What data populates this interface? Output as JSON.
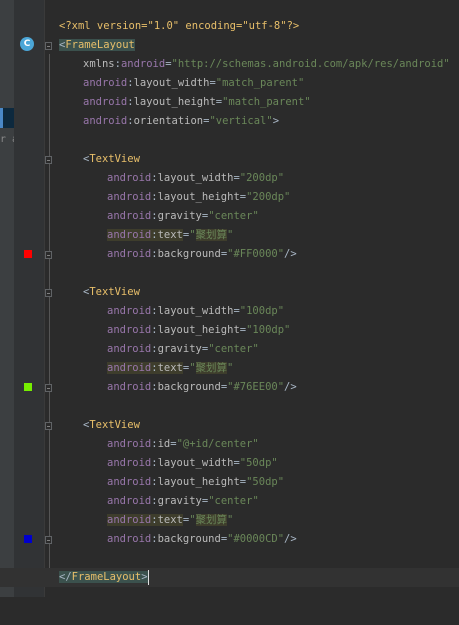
{
  "edge_text": "r a",
  "class_badge": "C",
  "lines": {
    "l1": {
      "decl": "<?xml version=\"1.0\" encoding=\"utf-8\"?>"
    },
    "l2": {
      "open": "<",
      "tag": "FrameLayout"
    },
    "l3": {
      "ns": "xmlns",
      "colon": ":",
      "attr": "android",
      "eq": "=",
      "val": "\"http://schemas.android.com/apk/res/android\""
    },
    "l4": {
      "ns": "android",
      "colon": ":",
      "attr": "layout_width",
      "eq": "=",
      "val": "\"match_parent\""
    },
    "l5": {
      "ns": "android",
      "colon": ":",
      "attr": "layout_height",
      "eq": "=",
      "val": "\"match_parent\""
    },
    "l6": {
      "ns": "android",
      "colon": ":",
      "attr": "orientation",
      "eq": "=",
      "val": "\"vertical\"",
      "close": ">"
    },
    "l8": {
      "open": "<",
      "tag": "TextView"
    },
    "l9": {
      "ns": "android",
      "colon": ":",
      "attr": "layout_width",
      "eq": "=",
      "val": "\"200dp\""
    },
    "l10": {
      "ns": "android",
      "colon": ":",
      "attr": "layout_height",
      "eq": "=",
      "val": "\"200dp\""
    },
    "l11": {
      "ns": "android",
      "colon": ":",
      "attr": "gravity",
      "eq": "=",
      "val": "\"center\""
    },
    "l12": {
      "ns": "android",
      "colon": ":",
      "attr": "text",
      "eq": "=",
      "q1": "\"",
      "val": "聚划算",
      "q2": "\""
    },
    "l13": {
      "ns": "android",
      "colon": ":",
      "attr": "background",
      "eq": "=",
      "val": "\"#FF0000\"",
      "close": "/>"
    },
    "l15": {
      "open": "<",
      "tag": "TextView"
    },
    "l16": {
      "ns": "android",
      "colon": ":",
      "attr": "layout_width",
      "eq": "=",
      "val": "\"100dp\""
    },
    "l17": {
      "ns": "android",
      "colon": ":",
      "attr": "layout_height",
      "eq": "=",
      "val": "\"100dp\""
    },
    "l18": {
      "ns": "android",
      "colon": ":",
      "attr": "gravity",
      "eq": "=",
      "val": "\"center\""
    },
    "l19": {
      "ns": "android",
      "colon": ":",
      "attr": "text",
      "eq": "=",
      "q1": "\"",
      "val": "聚划算",
      "q2": "\""
    },
    "l20": {
      "ns": "android",
      "colon": ":",
      "attr": "background",
      "eq": "=",
      "val": "\"#76EE00\"",
      "close": "/>"
    },
    "l22": {
      "open": "<",
      "tag": "TextView"
    },
    "l23": {
      "ns": "android",
      "colon": ":",
      "attr": "id",
      "eq": "=",
      "val": "\"@+id/center\""
    },
    "l24": {
      "ns": "android",
      "colon": ":",
      "attr": "layout_width",
      "eq": "=",
      "val": "\"50dp\""
    },
    "l25": {
      "ns": "android",
      "colon": ":",
      "attr": "layout_height",
      "eq": "=",
      "val": "\"50dp\""
    },
    "l26": {
      "ns": "android",
      "colon": ":",
      "attr": "gravity",
      "eq": "=",
      "val": "\"center\""
    },
    "l27": {
      "ns": "android",
      "colon": ":",
      "attr": "text",
      "eq": "=",
      "q1": "\"",
      "val": "聚划算",
      "q2": "\""
    },
    "l28": {
      "ns": "android",
      "colon": ":",
      "attr": "background",
      "eq": "=",
      "val": "\"#0000CD\"",
      "close": "/>"
    },
    "l30": {
      "open": "</",
      "tag": "FrameLayout",
      "close": ">"
    }
  },
  "swatches": [
    {
      "name": "red-color-swatch",
      "color": "#FF0000"
    },
    {
      "name": "green-color-swatch",
      "color": "#76EE00"
    },
    {
      "name": "blue-color-swatch",
      "color": "#0000CD"
    }
  ]
}
